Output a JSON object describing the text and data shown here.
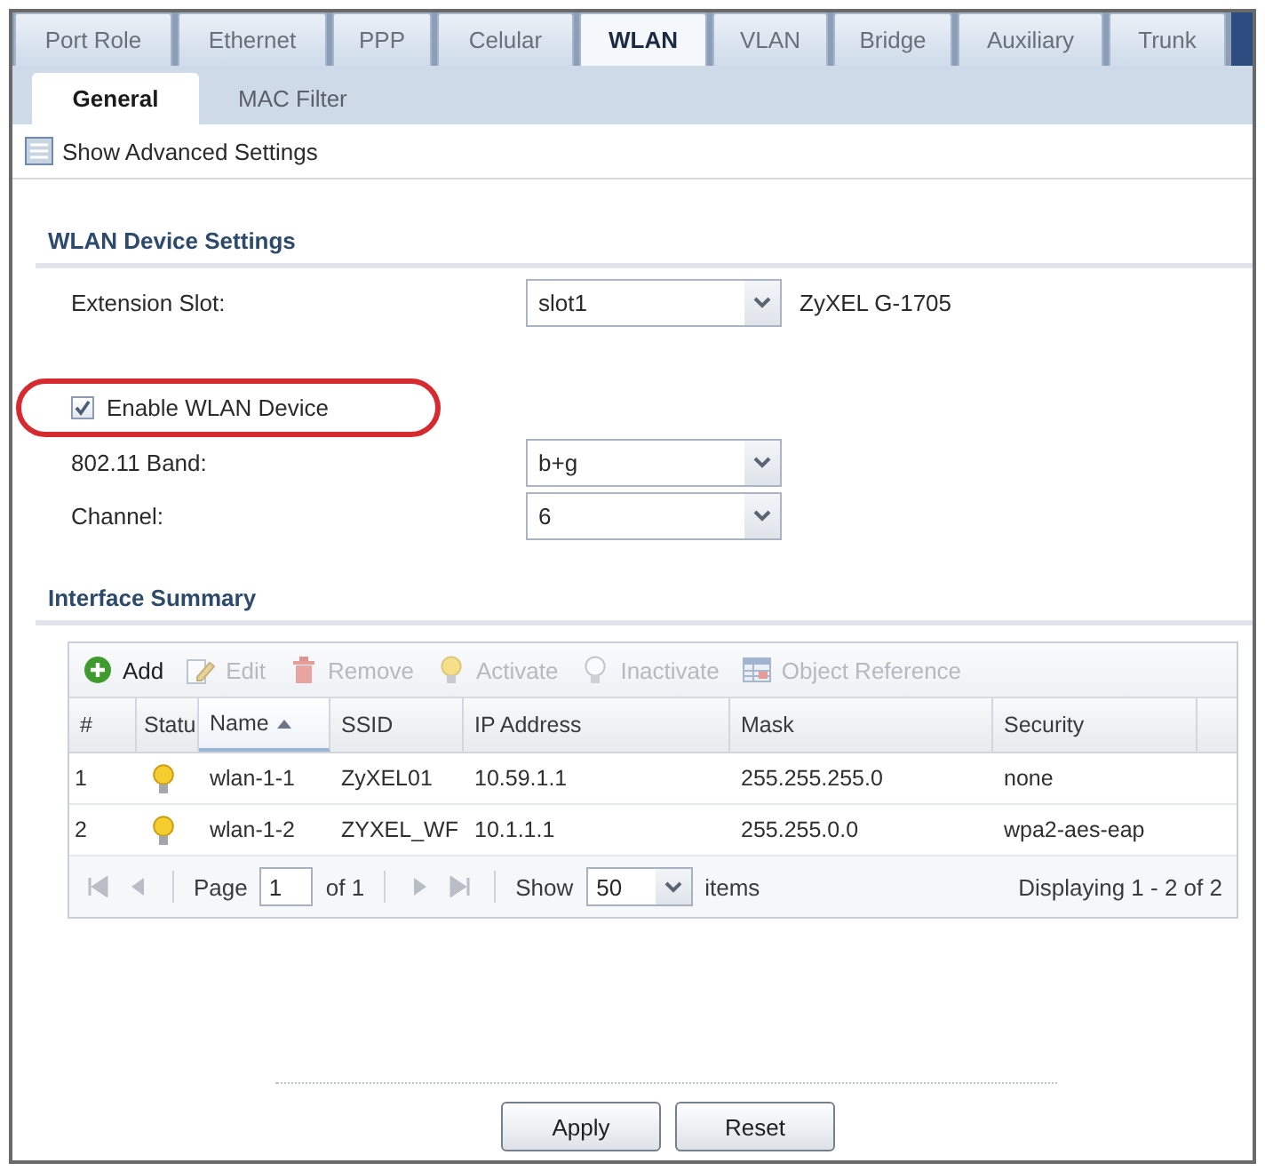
{
  "tabs": [
    {
      "label": "Port Role",
      "selected": false
    },
    {
      "label": "Ethernet",
      "selected": false
    },
    {
      "label": "PPP",
      "selected": false
    },
    {
      "label": "Celular",
      "selected": false
    },
    {
      "label": "WLAN",
      "selected": true
    },
    {
      "label": "VLAN",
      "selected": false
    },
    {
      "label": "Bridge",
      "selected": false
    },
    {
      "label": "Auxiliary",
      "selected": false
    },
    {
      "label": "Trunk",
      "selected": false
    }
  ],
  "subtabs": [
    {
      "label": "General",
      "selected": true
    },
    {
      "label": "MAC Filter",
      "selected": false
    }
  ],
  "advanced_toggle": {
    "label": "Show Advanced Settings"
  },
  "device_settings": {
    "title": "WLAN Device Settings",
    "fields": [
      {
        "kind": "select",
        "label": "Extension Slot:",
        "value": "slot1",
        "note": "ZyXEL G-1705"
      },
      {
        "kind": "checkbox",
        "label": "Enable WLAN Device",
        "checked": true,
        "highlighted": true
      },
      {
        "kind": "select",
        "label": "802.11 Band:",
        "value": "b+g"
      },
      {
        "kind": "select",
        "label": "Channel:",
        "value": "6"
      }
    ]
  },
  "interface_summary": {
    "title": "Interface Summary",
    "toolbar": [
      {
        "kind": "add",
        "label": "Add",
        "disabled": false
      },
      {
        "kind": "edit",
        "label": "Edit",
        "disabled": true
      },
      {
        "kind": "remove",
        "label": "Remove",
        "disabled": true
      },
      {
        "kind": "activate",
        "label": "Activate",
        "disabled": true
      },
      {
        "kind": "inactivate",
        "label": "Inactivate",
        "disabled": true
      },
      {
        "kind": "reference",
        "label": "Object Reference",
        "disabled": true
      }
    ],
    "table": {
      "columns": [
        {
          "label": "#",
          "sorted": false
        },
        {
          "label": "Statu",
          "sorted": false
        },
        {
          "label": "Name",
          "sorted": true
        },
        {
          "label": "SSID",
          "sorted": false
        },
        {
          "label": "IP Address",
          "sorted": false
        },
        {
          "label": "Mask",
          "sorted": false
        },
        {
          "label": "Security",
          "sorted": false
        }
      ],
      "rows": [
        {
          "number": "1",
          "active": true,
          "name": "wlan-1-1",
          "ssid": "ZyXEL01",
          "ip_address": "10.59.1.1",
          "mask": "255.255.255.0",
          "security": "none"
        },
        {
          "number": "2",
          "active": true,
          "name": "wlan-1-2",
          "ssid": "ZYXEL_WF",
          "ip_address": "10.1.1.1",
          "mask": "255.255.0.0",
          "security": "wpa2-aes-eap"
        }
      ]
    },
    "pager": {
      "nav": [
        {
          "kind": "first",
          "disabled": true
        },
        {
          "kind": "prev",
          "disabled": true
        },
        {
          "kind": "next",
          "disabled": true
        },
        {
          "kind": "last",
          "disabled": true
        }
      ],
      "page_label": "Page",
      "page": "1",
      "of_label": "of 1",
      "show_label": "Show",
      "page_size": "50",
      "items_label": "items",
      "summary": "Displaying 1 - 2 of 2"
    }
  },
  "buttons": [
    {
      "label": "Apply"
    },
    {
      "label": "Reset"
    }
  ]
}
